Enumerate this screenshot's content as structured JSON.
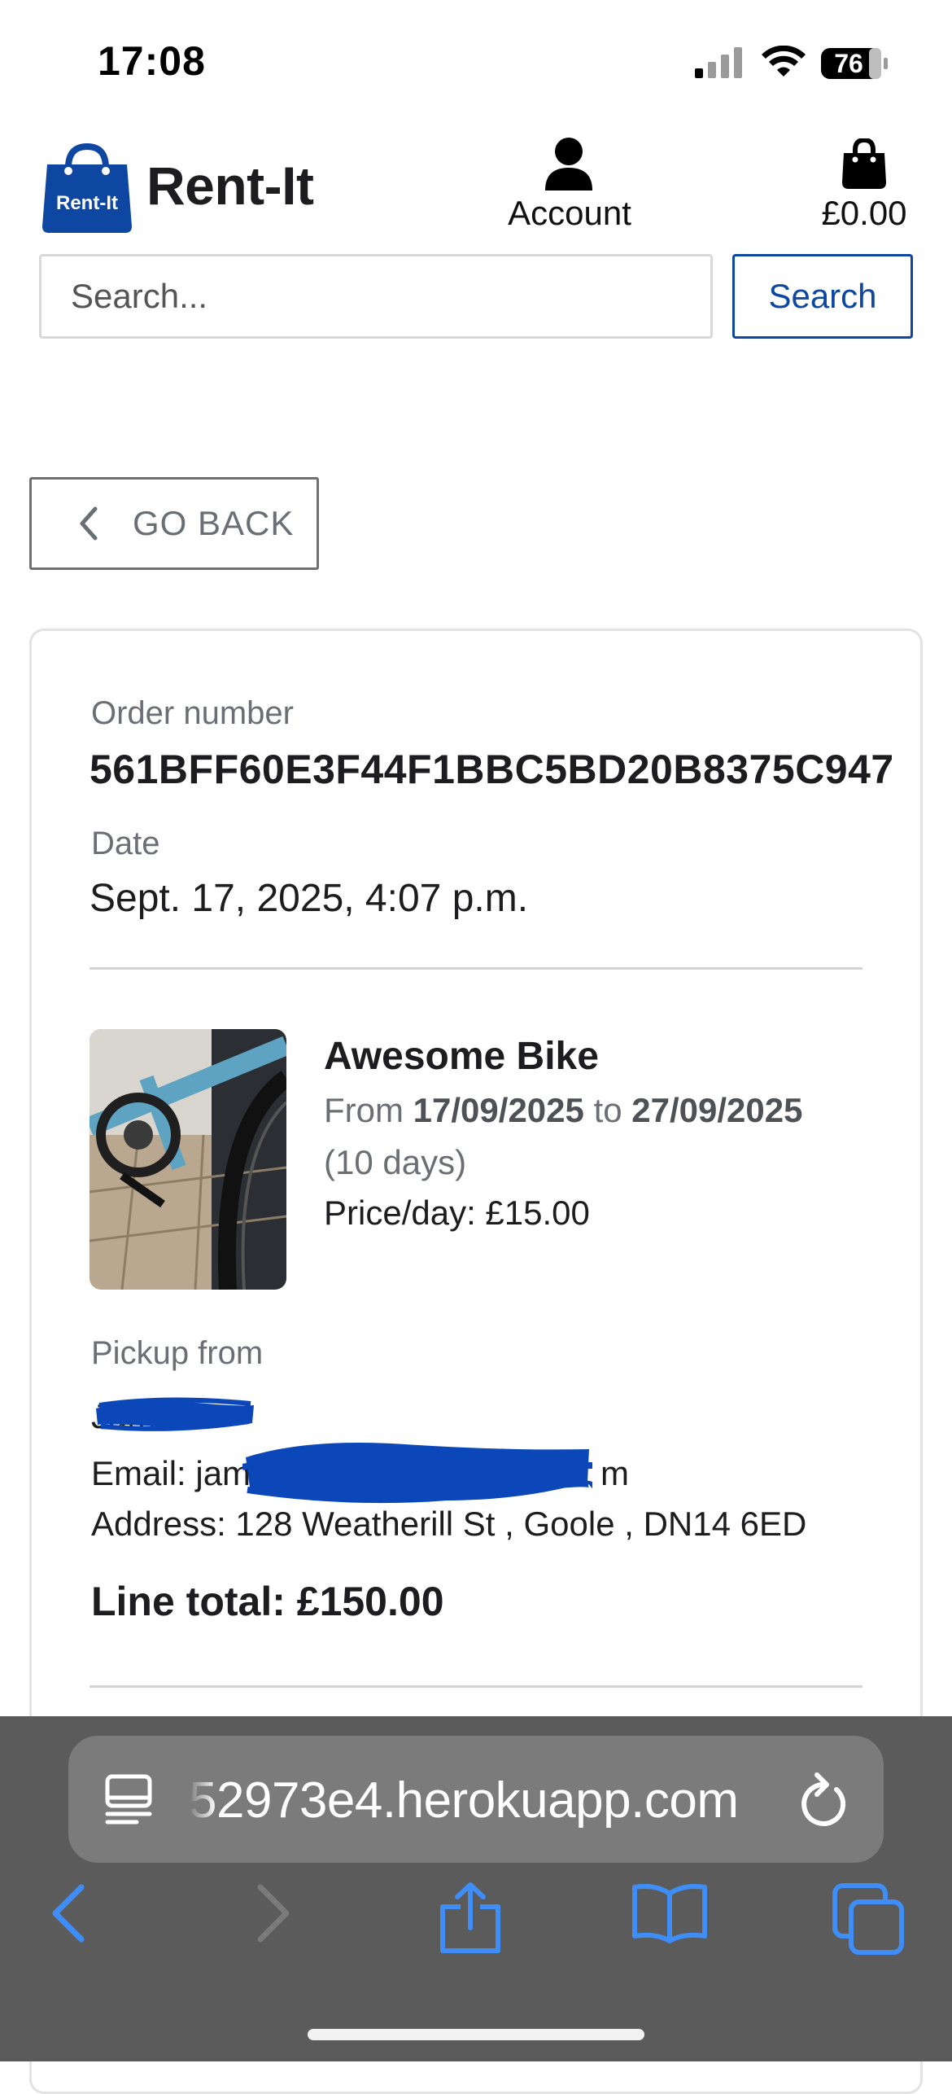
{
  "status_bar": {
    "time": "17:08",
    "battery_level": "76",
    "icons": [
      "cellular-signal-icon",
      "wifi-icon",
      "battery-icon"
    ]
  },
  "header": {
    "logo_text": "Rent-It",
    "brand": "Rent-It",
    "account_label": "Account",
    "cart_total": "£0.00"
  },
  "search": {
    "placeholder": "Search...",
    "button_label": "Search"
  },
  "go_back_label": "GO BACK",
  "order": {
    "number_label": "Order number",
    "number": "561BFF60E3F44F1BBC5BD20B8375C947",
    "date_label": "Date",
    "date": "Sept. 17, 2025, 4:07 p.m."
  },
  "item": {
    "name": "Awesome Bike",
    "from_word": "From",
    "start": "17/09/2025",
    "to_word": "to",
    "end": "27/09/2025",
    "days": "(10 days)",
    "price_per_day": "Price/day: £15.00"
  },
  "pickup": {
    "label": "Pickup from",
    "name": "James",
    "email_prefix": "Email: jam",
    "email_suffix": "m",
    "address": "Address: 128 Weatherill St , Goole , DN14 6ED",
    "line_total": "Line total: £150.00"
  },
  "browser": {
    "url": "52973e4.herokuapp.com"
  },
  "colors": {
    "brand_blue": "#0d47a1",
    "safari_blue": "#3f8ef7",
    "redaction_blue": "#0b47b8"
  }
}
